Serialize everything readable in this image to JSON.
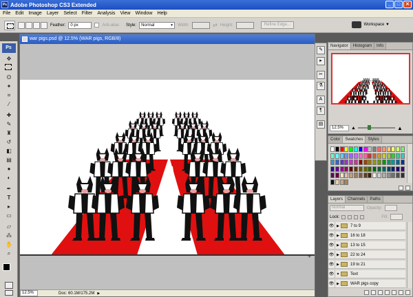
{
  "app": {
    "title": "Adobe Photoshop CS3 Extended",
    "icon_text": "Ps"
  },
  "window_buttons": {
    "minimize": "_",
    "maximize": "□",
    "close": "✕"
  },
  "menu": [
    "File",
    "Edit",
    "Image",
    "Layer",
    "Select",
    "Filter",
    "Analysis",
    "View",
    "Window",
    "Help"
  ],
  "options": {
    "feather_label": "Feather:",
    "feather_value": "0 px",
    "anti_alias_label": "Anti-alias",
    "style_label": "Style:",
    "style_value": "Normal",
    "width_label": "Width:",
    "height_label": "Height:",
    "refine_label": "Refine Edge...",
    "workspace_label": "Workspace ▼"
  },
  "document": {
    "title": "war pigs.psd @ 12.5% (WAR pigs, RGB/8)",
    "zoom": "12.5%",
    "doc_info": "Doc: 60.1M/175.2M"
  },
  "navigator": {
    "tabs": [
      "Navigator",
      "Histogram",
      "Info"
    ],
    "zoom": "12.5%"
  },
  "swatches": {
    "tabs": [
      "Color",
      "Swatches",
      "Styles"
    ],
    "colors": [
      "#ffffff",
      "#000000",
      "#ff0000",
      "#ffff00",
      "#00ff00",
      "#00ffff",
      "#0000ff",
      "#ff00ff",
      "#c0c0c0",
      "#808080",
      "#ff6666",
      "#ff9966",
      "#ffcc66",
      "#ffff66",
      "#ccff66",
      "#66ff66",
      "#66ffcc",
      "#66ffff",
      "#66ccff",
      "#6699ff",
      "#9966ff",
      "#cc66ff",
      "#ff66cc",
      "#ff6699",
      "#cc3333",
      "#cc6633",
      "#cc9933",
      "#cccc33",
      "#99cc33",
      "#33cc33",
      "#33cc99",
      "#33cccc",
      "#3399cc",
      "#3366cc",
      "#6633cc",
      "#9933cc",
      "#cc33cc",
      "#cc3399",
      "#990000",
      "#994400",
      "#997700",
      "#999900",
      "#669900",
      "#009900",
      "#009966",
      "#009999",
      "#006699",
      "#003399",
      "#330099",
      "#660099",
      "#990099",
      "#990066",
      "#660000",
      "#663300",
      "#665500",
      "#666600",
      "#336600",
      "#006600",
      "#006633",
      "#006666",
      "#004466",
      "#002266",
      "#220066",
      "#440066",
      "#660066",
      "#660044",
      "#ffe0c0",
      "#e0c0a0",
      "#c0a080",
      "#a08060",
      "#806040",
      "#604020",
      "#402000",
      "#f0f0f0",
      "#d0d0d0",
      "#b0b0b0",
      "#909090",
      "#707070",
      "#505050",
      "#303030",
      "#101010",
      "#e8d0b0",
      "#c8a880",
      "#a88858"
    ]
  },
  "layers": {
    "tabs": [
      "Layers",
      "Channels",
      "Paths"
    ],
    "blend_mode": "Normal",
    "opacity_label": "Opacity:",
    "lock_label": "Lock:",
    "fill_label": "Fill:",
    "rows": [
      {
        "name": "7 to 9",
        "expanded": false
      },
      {
        "name": "16 to 18",
        "expanded": false
      },
      {
        "name": "13 to 15",
        "expanded": false
      },
      {
        "name": "22 to 24",
        "expanded": false
      },
      {
        "name": "19 to 21",
        "expanded": false
      },
      {
        "name": "Text",
        "expanded": true
      },
      {
        "name": "WAR pigs copy",
        "expanded": false
      }
    ]
  },
  "colors": {
    "accent_red": "#e01010",
    "titlebar_blue": "#2b5cc4",
    "canvas_gray": "#c0c0c0"
  }
}
